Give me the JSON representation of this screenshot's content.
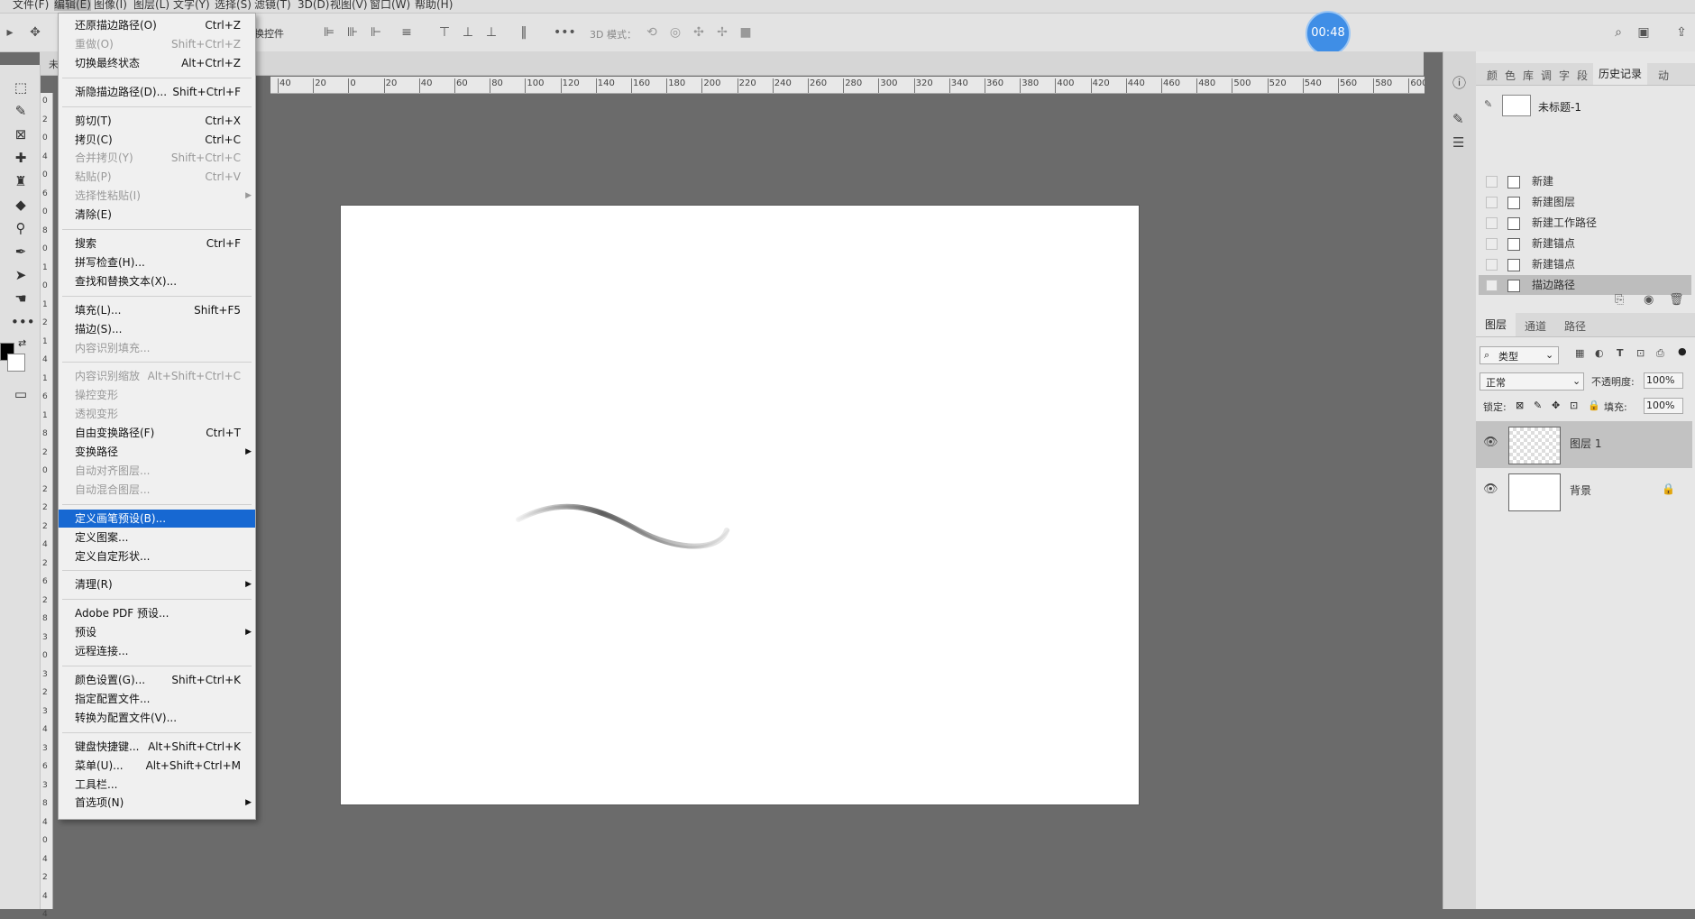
{
  "menubar": {
    "items": [
      "文件(F)",
      "编辑(E)",
      "图像(I)",
      "图层(L)",
      "文字(Y)",
      "选择(S)",
      "滤镜(T)",
      "3D(D)",
      "视图(V)",
      "窗口(W)",
      "帮助(H)"
    ],
    "active_index": 1
  },
  "options_bar": {
    "transform_label": "换控件",
    "mode_3d_label": "3D 模式："
  },
  "timer": {
    "text": "00:48",
    "color": "#3f8ee6"
  },
  "doc_tab": {
    "label": "未"
  },
  "ruler_h": {
    "labels": [
      "40",
      "20",
      "0",
      "20",
      "40",
      "60",
      "80",
      "100",
      "120",
      "140",
      "160",
      "180",
      "200",
      "220",
      "240",
      "260",
      "280",
      "300",
      "320",
      "340",
      "360",
      "380",
      "400",
      "420",
      "440",
      "460",
      "480",
      "500",
      "520",
      "540",
      "560",
      "580",
      "600"
    ]
  },
  "ruler_v": {
    "labels": [
      "0",
      "2",
      "0",
      "4",
      "0",
      "6",
      "0",
      "8",
      "0",
      "1",
      "0",
      "1",
      "2",
      "1",
      "4",
      "1",
      "6",
      "1",
      "8",
      "2",
      "0",
      "2",
      "2",
      "2",
      "4",
      "2",
      "6",
      "2",
      "8",
      "3",
      "0",
      "3",
      "2",
      "3",
      "4",
      "3",
      "6",
      "3",
      "8",
      "4",
      "0",
      "4",
      "2",
      "4",
      "4"
    ]
  },
  "edit_menu": {
    "items": [
      {
        "label": "还原描边路径(O)",
        "shortcut": "Ctrl+Z",
        "disabled": false
      },
      {
        "label": "重做(O)",
        "shortcut": "Shift+Ctrl+Z",
        "disabled": true
      },
      {
        "label": "切换最终状态",
        "shortcut": "Alt+Ctrl+Z",
        "disabled": false
      },
      {
        "sep": true
      },
      {
        "label": "渐隐描边路径(D)...",
        "shortcut": "Shift+Ctrl+F",
        "disabled": false
      },
      {
        "sep": true
      },
      {
        "label": "剪切(T)",
        "shortcut": "Ctrl+X",
        "disabled": false
      },
      {
        "label": "拷贝(C)",
        "shortcut": "Ctrl+C",
        "disabled": false
      },
      {
        "label": "合并拷贝(Y)",
        "shortcut": "Shift+Ctrl+C",
        "disabled": true
      },
      {
        "label": "粘贴(P)",
        "shortcut": "Ctrl+V",
        "disabled": true
      },
      {
        "label": "选择性粘贴(I)",
        "shortcut": "",
        "disabled": true,
        "submenu": true
      },
      {
        "label": "清除(E)",
        "shortcut": "",
        "disabled": false
      },
      {
        "sep": true
      },
      {
        "label": "搜索",
        "shortcut": "Ctrl+F",
        "disabled": false
      },
      {
        "label": "拼写检查(H)...",
        "shortcut": "",
        "disabled": false
      },
      {
        "label": "查找和替换文本(X)...",
        "shortcut": "",
        "disabled": false
      },
      {
        "sep": true
      },
      {
        "label": "填充(L)...",
        "shortcut": "Shift+F5",
        "disabled": false
      },
      {
        "label": "描边(S)...",
        "shortcut": "",
        "disabled": false
      },
      {
        "label": "内容识别填充...",
        "shortcut": "",
        "disabled": true
      },
      {
        "sep": true
      },
      {
        "label": "内容识别缩放",
        "shortcut": "Alt+Shift+Ctrl+C",
        "disabled": true
      },
      {
        "label": "操控变形",
        "shortcut": "",
        "disabled": true
      },
      {
        "label": "透视变形",
        "shortcut": "",
        "disabled": true
      },
      {
        "label": "自由变换路径(F)",
        "shortcut": "Ctrl+T",
        "disabled": false
      },
      {
        "label": "变换路径",
        "shortcut": "",
        "disabled": false,
        "submenu": true
      },
      {
        "label": "自动对齐图层...",
        "shortcut": "",
        "disabled": true
      },
      {
        "label": "自动混合图层...",
        "shortcut": "",
        "disabled": true
      },
      {
        "sep": true
      },
      {
        "label": "定义画笔预设(B)...",
        "shortcut": "",
        "disabled": false,
        "highlight": true
      },
      {
        "label": "定义图案...",
        "shortcut": "",
        "disabled": false
      },
      {
        "label": "定义自定形状...",
        "shortcut": "",
        "disabled": false
      },
      {
        "sep": true
      },
      {
        "label": "清理(R)",
        "shortcut": "",
        "disabled": false,
        "submenu": true
      },
      {
        "sep": true
      },
      {
        "label": "Adobe PDF 预设...",
        "shortcut": "",
        "disabled": false
      },
      {
        "label": "预设",
        "shortcut": "",
        "disabled": false,
        "submenu": true
      },
      {
        "label": "远程连接...",
        "shortcut": "",
        "disabled": false
      },
      {
        "sep": true
      },
      {
        "label": "颜色设置(G)...",
        "shortcut": "Shift+Ctrl+K",
        "disabled": false
      },
      {
        "label": "指定配置文件...",
        "shortcut": "",
        "disabled": false
      },
      {
        "label": "转换为配置文件(V)...",
        "shortcut": "",
        "disabled": false
      },
      {
        "sep": true
      },
      {
        "label": "键盘快捷键...",
        "shortcut": "Alt+Shift+Ctrl+K",
        "disabled": false
      },
      {
        "label": "菜单(U)...",
        "shortcut": "Alt+Shift+Ctrl+M",
        "disabled": false
      },
      {
        "label": "工具栏...",
        "shortcut": "",
        "disabled": false
      },
      {
        "label": "首选项(N)",
        "shortcut": "",
        "disabled": false,
        "submenu": true
      }
    ]
  },
  "panel_tabs_top": [
    "颜",
    "色",
    "库",
    "调",
    "字",
    "段",
    "历史记录",
    "动"
  ],
  "history": {
    "snapshot": "未标题-1",
    "items": [
      "新建",
      "新建图层",
      "新建工作路径",
      "新建锚点",
      "新建锚点",
      "描边路径"
    ],
    "selected_index": 5
  },
  "layers_panel": {
    "tabs": [
      "图层",
      "通道",
      "路径"
    ],
    "filter_label": "类型",
    "blend_mode": "正常",
    "opacity_label": "不透明度:",
    "opacity_value": "100%",
    "lock_label": "锁定:",
    "fill_label": "填充:",
    "fill_value": "100%",
    "layers": [
      {
        "name": "图层 1",
        "selected": true
      },
      {
        "name": "背景",
        "selected": false,
        "locked": true
      }
    ]
  },
  "colors": {
    "highlight": "#1768d2",
    "foreground": "#000000",
    "background": "#ffffff"
  }
}
